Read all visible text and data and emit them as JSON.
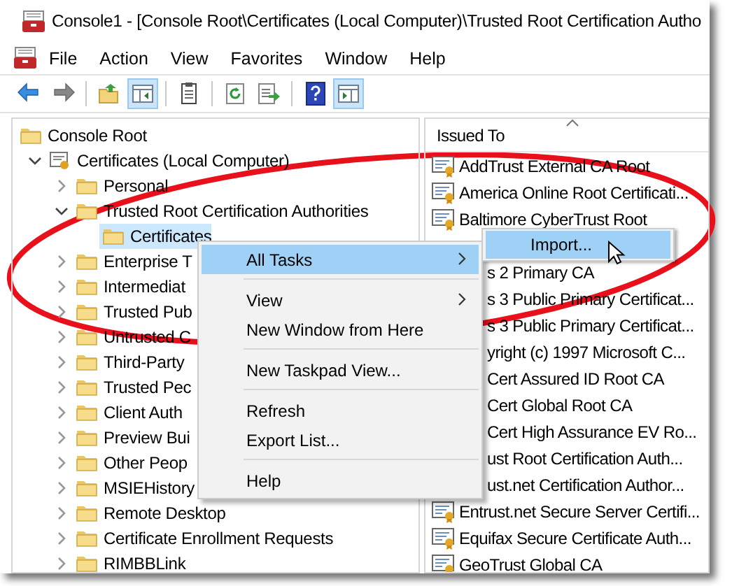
{
  "window": {
    "title": "Console1 - [Console Root\\Certificates (Local Computer)\\Trusted Root Certification Autho"
  },
  "menu_bar": [
    "File",
    "Action",
    "View",
    "Favorites",
    "Window",
    "Help"
  ],
  "toolbar": [
    {
      "kind": "back",
      "pressed": false
    },
    {
      "kind": "forward",
      "pressed": false
    },
    {
      "kind": "up",
      "pressed": false
    },
    {
      "kind": "tree",
      "pressed": true
    },
    {
      "kind": "clipboard",
      "pressed": false
    },
    {
      "kind": "refresh",
      "pressed": false
    },
    {
      "kind": "export",
      "pressed": false
    },
    {
      "kind": "help",
      "pressed": false
    },
    {
      "kind": "actionpane",
      "pressed": true
    }
  ],
  "tree": [
    {
      "label": "Console Root",
      "kind": "folder",
      "selected": false,
      "children": [
        {
          "label": "Certificates (Local Computer)",
          "kind": "store",
          "expanded": true,
          "selected": false,
          "children": [
            {
              "label": "Personal",
              "kind": "folder",
              "expanded": false,
              "selected": false
            },
            {
              "label": "Trusted Root Certification Authorities",
              "kind": "folder",
              "expanded": true,
              "selected": false,
              "children": [
                {
                  "label": "Certificates",
                  "kind": "folder",
                  "selected": true
                }
              ]
            },
            {
              "label": "Enterprise T",
              "kind": "folder",
              "expanded": false,
              "selected": false
            },
            {
              "label": "Intermediat",
              "kind": "folder",
              "expanded": false,
              "selected": false
            },
            {
              "label": "Trusted Pub",
              "kind": "folder",
              "expanded": false,
              "selected": false
            },
            {
              "label": "Untrusted C",
              "kind": "folder",
              "expanded": false,
              "selected": false
            },
            {
              "label": "Third-Party",
              "kind": "folder",
              "expanded": false,
              "selected": false
            },
            {
              "label": "Trusted Pec",
              "kind": "folder",
              "expanded": false,
              "selected": false
            },
            {
              "label": "Client Auth",
              "kind": "folder",
              "expanded": false,
              "selected": false
            },
            {
              "label": "Preview Bui",
              "kind": "folder",
              "expanded": false,
              "selected": false
            },
            {
              "label": "Other Peop",
              "kind": "folder",
              "expanded": false,
              "selected": false
            },
            {
              "label": "MSIEHistory",
              "kind": "folder",
              "expanded": false,
              "selected": false
            },
            {
              "label": "Remote Desktop",
              "kind": "folder",
              "expanded": false,
              "selected": false
            },
            {
              "label": "Certificate Enrollment Requests",
              "kind": "folder",
              "expanded": false,
              "selected": false
            },
            {
              "label": "RIMBBLink",
              "kind": "folder",
              "expanded": false,
              "selected": false
            }
          ]
        }
      ]
    }
  ],
  "list": {
    "columns": [
      "Issued To"
    ],
    "rows": [
      {
        "kind": "full",
        "text": "AddTrust External CA Root"
      },
      {
        "kind": "full",
        "text": "America Online Root Certificati..."
      },
      {
        "kind": "full",
        "text": "Baltimore CyberTrust Root"
      },
      {
        "kind": "clipped",
        "text": "s 2 Primary CA"
      },
      {
        "kind": "clipped",
        "text": "s 3 Public Primary Certificat..."
      },
      {
        "kind": "clipped",
        "text": "s 3 Public Primary Certificat..."
      },
      {
        "kind": "clipped",
        "text": "yright (c) 1997 Microsoft C..."
      },
      {
        "kind": "clipped",
        "text": "Cert Assured ID Root CA"
      },
      {
        "kind": "clipped",
        "text": "Cert Global Root CA"
      },
      {
        "kind": "clipped",
        "text": "Cert High Assurance EV Ro..."
      },
      {
        "kind": "clipped",
        "text": "ust Root Certification Auth..."
      },
      {
        "kind": "clipped",
        "text": "ust.net Certification Author..."
      },
      {
        "kind": "full",
        "text": "Entrust.net Secure Server Certifi..."
      },
      {
        "kind": "full",
        "text": "Equifax Secure Certificate Auth..."
      },
      {
        "kind": "full",
        "text": "GeoTrust Global CA"
      }
    ]
  },
  "context_menu": [
    {
      "kind": "item",
      "label": "All Tasks",
      "submenu": true,
      "selected": true
    },
    {
      "kind": "separator"
    },
    {
      "kind": "item",
      "label": "View",
      "submenu": true,
      "selected": false
    },
    {
      "kind": "item",
      "label": "New Window from Here",
      "submenu": false,
      "selected": false
    },
    {
      "kind": "separator"
    },
    {
      "kind": "item",
      "label": "New Taskpad View...",
      "submenu": false,
      "selected": false
    },
    {
      "kind": "separator"
    },
    {
      "kind": "item",
      "label": "Refresh",
      "submenu": false,
      "selected": false
    },
    {
      "kind": "item",
      "label": "Export List...",
      "submenu": false,
      "selected": false
    },
    {
      "kind": "separator"
    },
    {
      "kind": "item",
      "label": "Help",
      "submenu": false,
      "selected": false
    }
  ],
  "submenu": [
    {
      "label": "Import...",
      "selected": true
    }
  ]
}
